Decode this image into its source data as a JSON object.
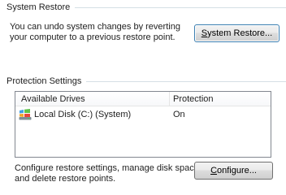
{
  "system_restore": {
    "group_title": "System Restore",
    "description_line1": "You can undo system changes by reverting",
    "description_line2": "your computer to a previous restore point.",
    "button_prefix": "S",
    "button_rest": "ystem Restore..."
  },
  "protection": {
    "group_title": "Protection Settings",
    "columns": {
      "drive": "Available Drives",
      "protection": "Protection"
    },
    "drives": [
      {
        "name": "Local Disk (C:) (System)",
        "protection": "On",
        "icon": "local-disk-icon"
      }
    ],
    "description_line1": "Configure restore settings, manage disk space,",
    "description_line2": "and delete restore points.",
    "configure_prefix": "C",
    "configure_rest": "onfigure..."
  }
}
